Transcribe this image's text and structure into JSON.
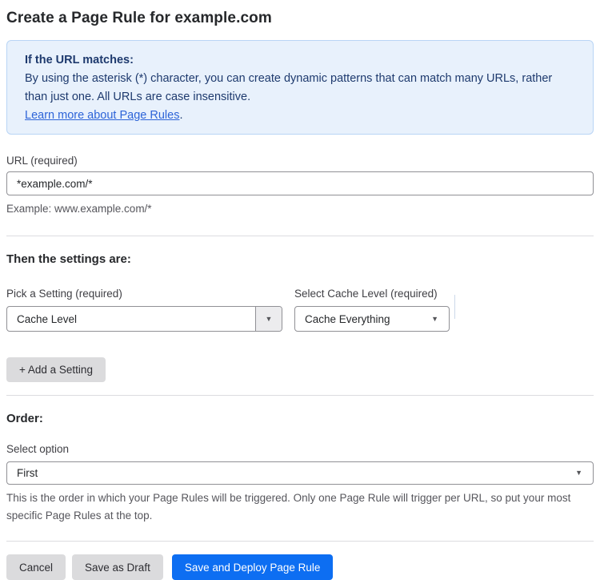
{
  "page": {
    "title": "Create a Page Rule for example.com"
  },
  "info_box": {
    "heading": "If the URL matches:",
    "body": "By using the asterisk (*) character, you can create dynamic patterns that can match many URLs, rather than just one. All URLs are case insensitive.",
    "link_label": "Learn more about Page Rules",
    "link_suffix": "."
  },
  "url_field": {
    "label": "URL (required)",
    "value": "*example.com/*",
    "helper": "Example: www.example.com/*"
  },
  "settings": {
    "heading": "Then the settings are:",
    "setting_picker": {
      "label": "Pick a Setting (required)",
      "selected": "Cache Level",
      "caret": "▼"
    },
    "cache_level_picker": {
      "label": "Select Cache Level (required)",
      "selected": "Cache Everything",
      "caret": "▼"
    },
    "add_setting_label": "+ Add a Setting"
  },
  "order": {
    "heading": "Order:",
    "label": "Select option",
    "selected": "First",
    "caret": "▼",
    "helper": "This is the order in which your Page Rules will be triggered. Only one Page Rule will trigger per URL, so put your most specific Page Rules at the top."
  },
  "actions": {
    "cancel": "Cancel",
    "save_draft": "Save as Draft",
    "save_deploy": "Save and Deploy Page Rule"
  },
  "colors": {
    "accent_blue": "#0d6ef2",
    "info_bg": "#e8f1fc",
    "info_border": "#b9d5f5",
    "info_text": "#1e3a6e",
    "link_blue": "#2d64d8"
  }
}
